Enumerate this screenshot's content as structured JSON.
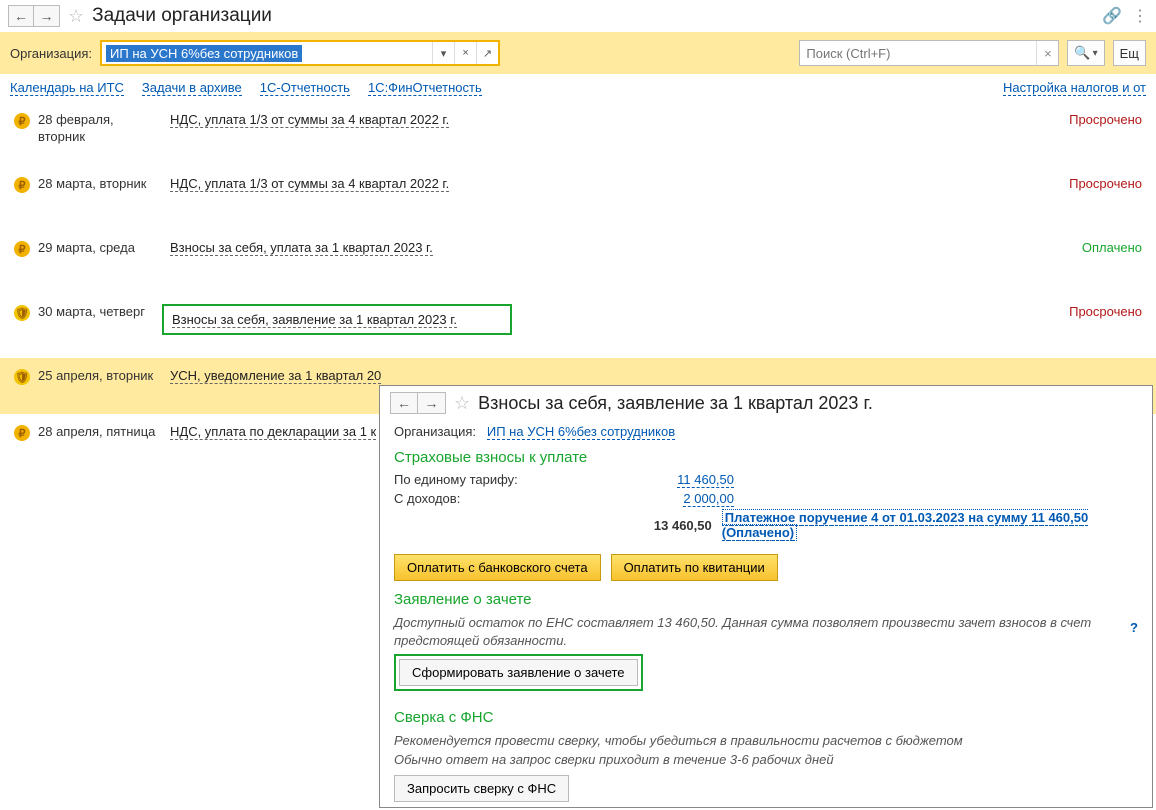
{
  "header": {
    "title": "Задачи организации"
  },
  "orgbar": {
    "label": "Организация:",
    "value": "ИП на УСН 6%без сотрудников",
    "search_placeholder": "Поиск (Ctrl+F)",
    "more": "Ещ"
  },
  "links": {
    "its": "Календарь на ИТС",
    "archive": "Задачи в архиве",
    "otchet1c": "1С-Отчетность",
    "finotchet": "1С:ФинОтчетность",
    "tax_settings": "Настройка налогов и от"
  },
  "tasks": [
    {
      "date_l1": "28 февраля,",
      "date_l2": "вторник",
      "title": "НДС, уплата 1/3 от суммы за 4 квартал 2022 г.",
      "status": "Просрочено",
      "status_cls": "st-red",
      "icon": "ruble"
    },
    {
      "date_l1": "28 марта, вторник",
      "date_l2": "",
      "title": "НДС, уплата 1/3 от суммы за 4 квартал 2022 г.",
      "status": "Просрочено",
      "status_cls": "st-red",
      "icon": "ruble"
    },
    {
      "date_l1": "29 марта, среда",
      "date_l2": "",
      "title": "Взносы за себя, уплата за 1 квартал 2023 г.",
      "status": "Оплачено",
      "status_cls": "st-green",
      "icon": "ruble"
    },
    {
      "date_l1": "30 марта, четверг",
      "date_l2": "",
      "title": "Взносы за себя, заявление за 1 квартал 2023 г.",
      "status": "Просрочено",
      "status_cls": "st-red",
      "icon": "shield",
      "boxed": true
    },
    {
      "date_l1": "25 апреля, вторник",
      "date_l2": "",
      "title": "УСН, уведомление за 1 квартал 20",
      "status": "",
      "status_cls": "",
      "icon": "shield",
      "selected": true
    },
    {
      "date_l1": "28 апреля, пятница",
      "date_l2": "",
      "title": "НДС, уплата по декларации за 1 к",
      "status": "",
      "status_cls": "",
      "icon": "ruble"
    }
  ],
  "detail": {
    "title": "Взносы за себя, заявление за 1 квартал 2023 г.",
    "org_label": "Организация:",
    "org_value": "ИП на УСН 6%без сотрудников",
    "section_contrib": "Страховые взносы к уплате",
    "rows": {
      "unified_k": "По единому тарифу:",
      "unified_v": "11 460,50",
      "income_k": "С доходов:",
      "income_v": "2 000,00",
      "total": "13 460,50",
      "payment_link": "Платежное поручение 4 от 01.03.2023 на сумму 11 460,50 (Оплачено)"
    },
    "btn_bank": "Оплатить с банковского счета",
    "btn_receipt": "Оплатить по квитанции",
    "section_offset": "Заявление о зачете",
    "offset_hint": "Доступный остаток по ЕНС составляет 13 460,50. Данная сумма позволяет произвести зачет взносов в счет предстоящей обязанности.",
    "btn_form": "Сформировать заявление о зачете",
    "section_fns": "Сверка с ФНС",
    "fns_hint1": "Рекомендуется провести сверку, чтобы убедиться в правильности расчетов с бюджетом",
    "fns_hint2": "Обычно ответ на запрос сверки приходит в течение 3-6 рабочих дней",
    "btn_fns": "Запросить сверку с ФНС",
    "help": "?"
  }
}
